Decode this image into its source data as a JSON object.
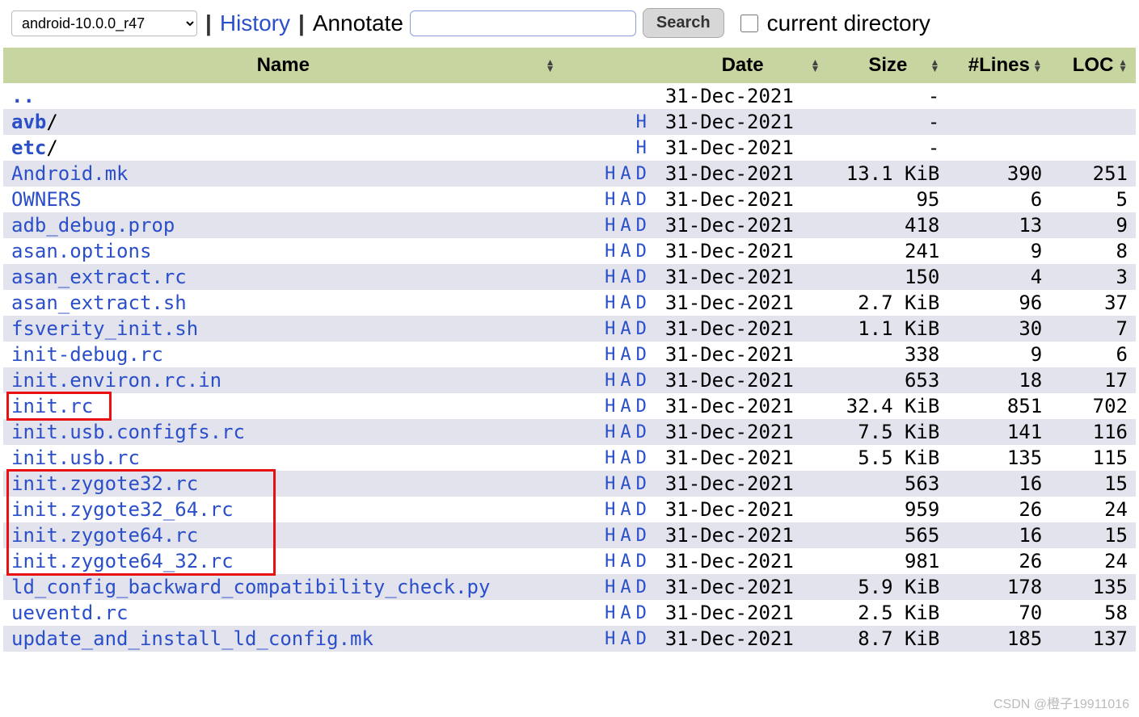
{
  "toolbar": {
    "branch_selected": "android-10.0.0_r47",
    "history_label": "History",
    "annotate_label": "Annotate",
    "search_value": "",
    "search_button": "Search",
    "current_dir_label": "current directory",
    "current_dir_checked": false
  },
  "columns": {
    "name": "Name",
    "date": "Date",
    "size": "Size",
    "lines": "#Lines",
    "loc": "LOC"
  },
  "rows": [
    {
      "name": "..",
      "is_dir": true,
      "bold": true,
      "links": "",
      "date": "31-Dec-2021",
      "size": "-",
      "lines": "",
      "loc": ""
    },
    {
      "name": "avb",
      "is_dir": true,
      "bold": true,
      "links": "H",
      "date": "31-Dec-2021",
      "size": "-",
      "lines": "",
      "loc": ""
    },
    {
      "name": "etc",
      "is_dir": true,
      "bold": true,
      "links": "H",
      "date": "31-Dec-2021",
      "size": "-",
      "lines": "",
      "loc": ""
    },
    {
      "name": "Android.mk",
      "is_dir": false,
      "bold": false,
      "links": "HAD",
      "date": "31-Dec-2021",
      "size": "13.1 KiB",
      "lines": "390",
      "loc": "251"
    },
    {
      "name": "OWNERS",
      "is_dir": false,
      "bold": false,
      "links": "HAD",
      "date": "31-Dec-2021",
      "size": "95",
      "lines": "6",
      "loc": "5"
    },
    {
      "name": "adb_debug.prop",
      "is_dir": false,
      "bold": false,
      "links": "HAD",
      "date": "31-Dec-2021",
      "size": "418",
      "lines": "13",
      "loc": "9"
    },
    {
      "name": "asan.options",
      "is_dir": false,
      "bold": false,
      "links": "HAD",
      "date": "31-Dec-2021",
      "size": "241",
      "lines": "9",
      "loc": "8"
    },
    {
      "name": "asan_extract.rc",
      "is_dir": false,
      "bold": false,
      "links": "HAD",
      "date": "31-Dec-2021",
      "size": "150",
      "lines": "4",
      "loc": "3"
    },
    {
      "name": "asan_extract.sh",
      "is_dir": false,
      "bold": false,
      "links": "HAD",
      "date": "31-Dec-2021",
      "size": "2.7 KiB",
      "lines": "96",
      "loc": "37"
    },
    {
      "name": "fsverity_init.sh",
      "is_dir": false,
      "bold": false,
      "links": "HAD",
      "date": "31-Dec-2021",
      "size": "1.1 KiB",
      "lines": "30",
      "loc": "7"
    },
    {
      "name": "init-debug.rc",
      "is_dir": false,
      "bold": false,
      "links": "HAD",
      "date": "31-Dec-2021",
      "size": "338",
      "lines": "9",
      "loc": "6"
    },
    {
      "name": "init.environ.rc.in",
      "is_dir": false,
      "bold": false,
      "links": "HAD",
      "date": "31-Dec-2021",
      "size": "653",
      "lines": "18",
      "loc": "17"
    },
    {
      "name": "init.rc",
      "is_dir": false,
      "bold": false,
      "links": "HAD",
      "date": "31-Dec-2021",
      "size": "32.4 KiB",
      "lines": "851",
      "loc": "702"
    },
    {
      "name": "init.usb.configfs.rc",
      "is_dir": false,
      "bold": false,
      "links": "HAD",
      "date": "31-Dec-2021",
      "size": "7.5 KiB",
      "lines": "141",
      "loc": "116"
    },
    {
      "name": "init.usb.rc",
      "is_dir": false,
      "bold": false,
      "links": "HAD",
      "date": "31-Dec-2021",
      "size": "5.5 KiB",
      "lines": "135",
      "loc": "115"
    },
    {
      "name": "init.zygote32.rc",
      "is_dir": false,
      "bold": false,
      "links": "HAD",
      "date": "31-Dec-2021",
      "size": "563",
      "lines": "16",
      "loc": "15"
    },
    {
      "name": "init.zygote32_64.rc",
      "is_dir": false,
      "bold": false,
      "links": "HAD",
      "date": "31-Dec-2021",
      "size": "959",
      "lines": "26",
      "loc": "24"
    },
    {
      "name": "init.zygote64.rc",
      "is_dir": false,
      "bold": false,
      "links": "HAD",
      "date": "31-Dec-2021",
      "size": "565",
      "lines": "16",
      "loc": "15"
    },
    {
      "name": "init.zygote64_32.rc",
      "is_dir": false,
      "bold": false,
      "links": "HAD",
      "date": "31-Dec-2021",
      "size": "981",
      "lines": "26",
      "loc": "24"
    },
    {
      "name": "ld_config_backward_compatibility_check.py",
      "is_dir": false,
      "bold": false,
      "links": "HAD",
      "date": "31-Dec-2021",
      "size": "5.9 KiB",
      "lines": "178",
      "loc": "135"
    },
    {
      "name": "ueventd.rc",
      "is_dir": false,
      "bold": false,
      "links": "HAD",
      "date": "31-Dec-2021",
      "size": "2.5 KiB",
      "lines": "70",
      "loc": "58"
    },
    {
      "name": "update_and_install_ld_config.mk",
      "is_dir": false,
      "bold": false,
      "links": "HAD",
      "date": "31-Dec-2021",
      "size": "8.7 KiB",
      "lines": "185",
      "loc": "137"
    }
  ],
  "highlight_boxes": [
    {
      "row_start": 12,
      "row_end": 12,
      "width_chars": 8
    },
    {
      "row_start": 15,
      "row_end": 18,
      "width_chars": 22
    }
  ],
  "watermark": "CSDN @橙子19911016"
}
